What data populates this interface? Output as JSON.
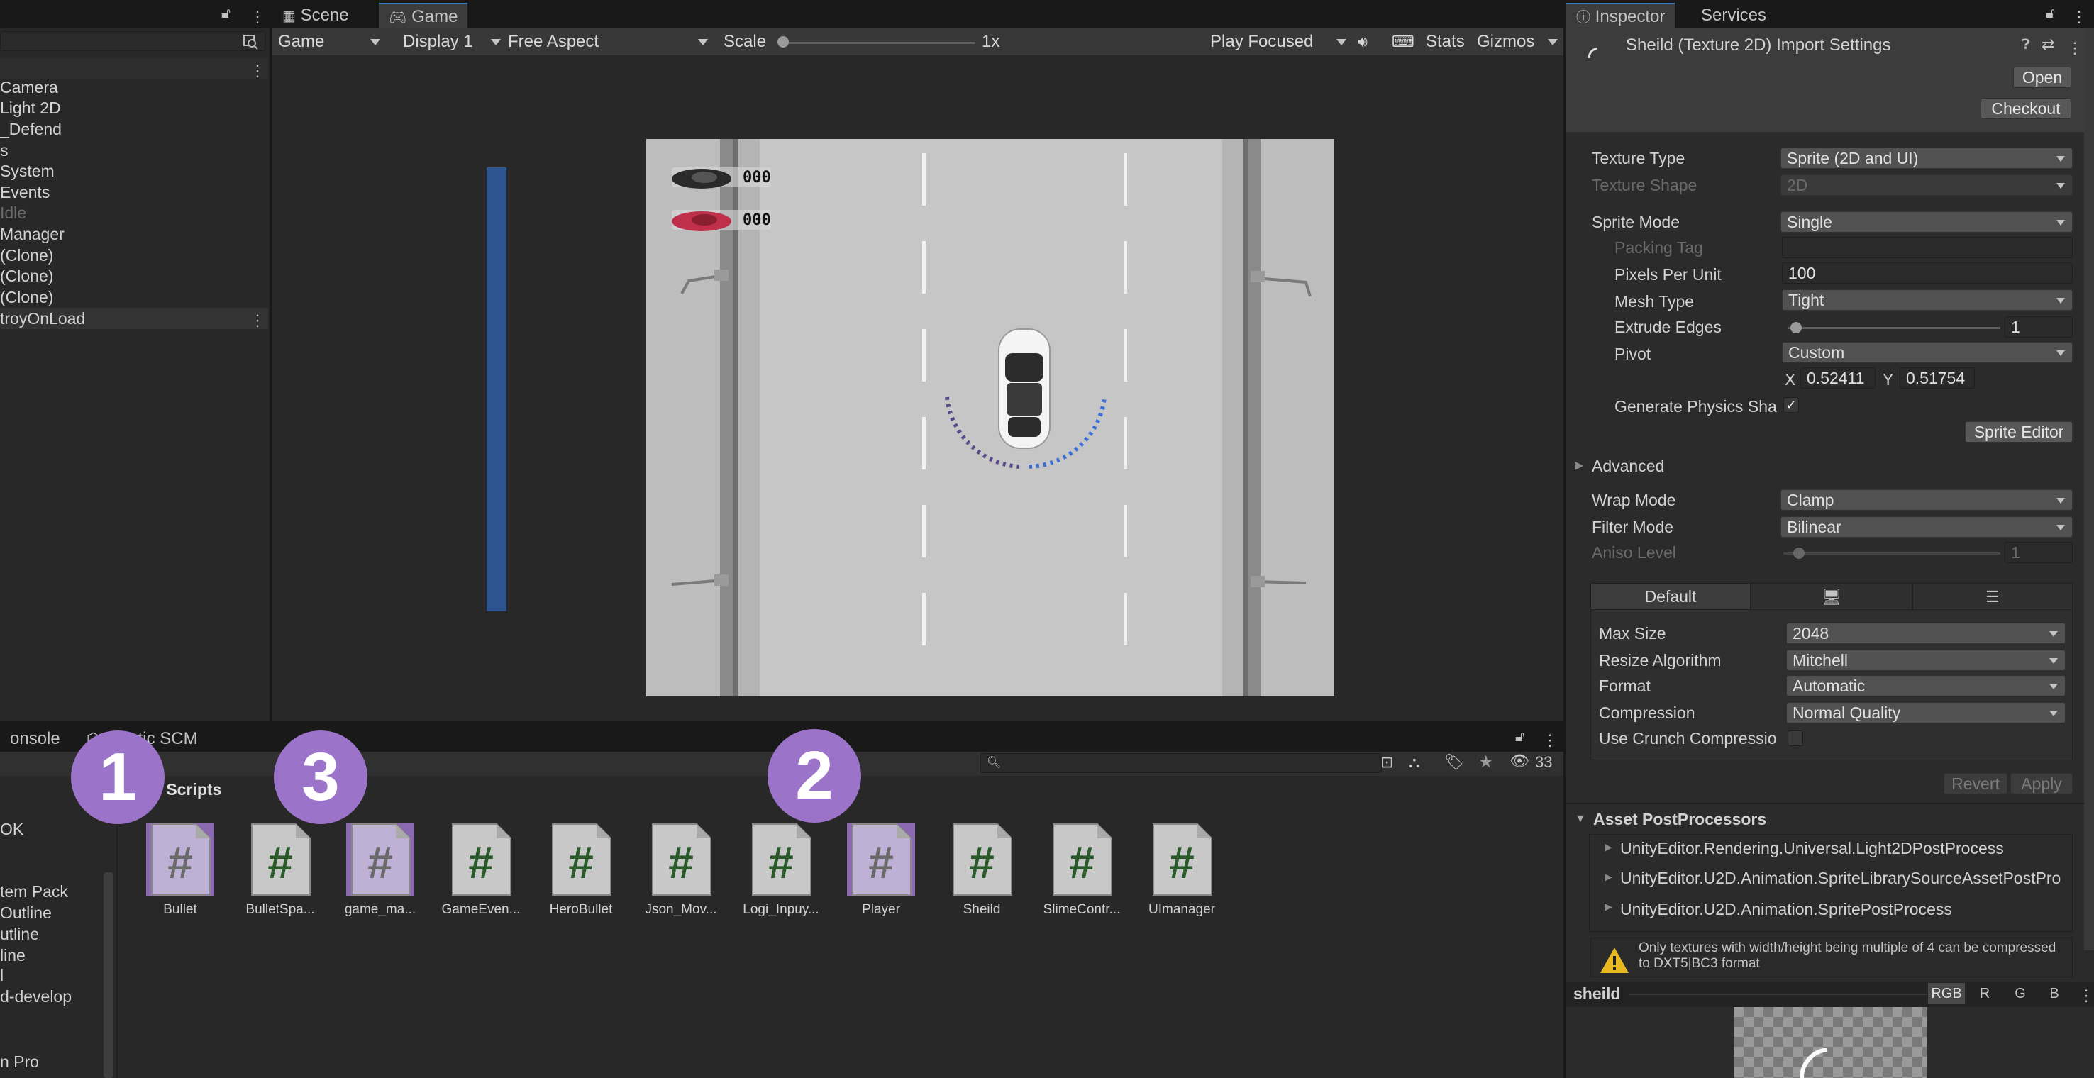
{
  "hierarchy": {
    "items": [
      "Camera",
      "Light 2D",
      "_Defend",
      "s",
      "System",
      "Events",
      "Idle",
      "Manager",
      "(Clone)",
      "(Clone)",
      "(Clone)",
      "troyOnLoad"
    ]
  },
  "tabs": {
    "scene": "Scene",
    "game": "Game",
    "inspector": "Inspector",
    "services": "Services",
    "console": "onsole",
    "plastic": "Plastic SCM"
  },
  "game_toolbar": {
    "mode": "Game",
    "display": "Display 1",
    "aspect": "Free Aspect",
    "scale_label": "Scale",
    "scale_value": "1x",
    "play_mode": "Play Focused",
    "stats": "Stats",
    "gizmos": "Gizmos"
  },
  "game_view": {
    "hud_score_1": "000",
    "hud_score_2": "000"
  },
  "inspector": {
    "title": "Sheild (Texture 2D) Import Settings",
    "open_button": "Open",
    "checkout_button": "Checkout",
    "texture_type_label": "Texture Type",
    "texture_type_value": "Sprite (2D and UI)",
    "texture_shape_label": "Texture Shape",
    "texture_shape_value": "2D",
    "sprite_mode_label": "Sprite Mode",
    "sprite_mode_value": "Single",
    "packing_tag_label": "Packing Tag",
    "pixels_per_unit_label": "Pixels Per Unit",
    "pixels_per_unit_value": "100",
    "mesh_type_label": "Mesh Type",
    "mesh_type_value": "Tight",
    "extrude_edges_label": "Extrude Edges",
    "extrude_edges_value": "1",
    "pivot_label": "Pivot",
    "pivot_value": "Custom",
    "pivot_x_label": "X",
    "pivot_x_value": "0.52411",
    "pivot_y_label": "Y",
    "pivot_y_value": "0.51754",
    "gen_physics_label": "Generate Physics Sha",
    "sprite_editor_button": "Sprite Editor",
    "advanced_label": "Advanced",
    "wrap_mode_label": "Wrap Mode",
    "wrap_mode_value": "Clamp",
    "filter_mode_label": "Filter Mode",
    "filter_mode_value": "Bilinear",
    "aniso_label": "Aniso Level",
    "aniso_value": "1",
    "platform_default": "Default",
    "max_size_label": "Max Size",
    "max_size_value": "2048",
    "resize_label": "Resize Algorithm",
    "resize_value": "Mitchell",
    "format_label": "Format",
    "format_value": "Automatic",
    "compression_label": "Compression",
    "compression_value": "Normal Quality",
    "crunch_label": "Use Crunch Compressio",
    "revert_button": "Revert",
    "apply_button": "Apply",
    "postprocessors_label": "Asset PostProcessors",
    "postprocessors": [
      "UnityEditor.Rendering.Universal.Light2DPostProcess",
      "UnityEditor.U2D.Animation.SpriteLibrarySourceAssetPostPro",
      "UnityEditor.U2D.Animation.SpritePostProcess"
    ],
    "warning_text": "Only textures with width/height being multiple of 4 can be compressed to DXT5|BC3 format",
    "preview_name": "sheild",
    "channels": [
      "RGB",
      "R",
      "G",
      "B"
    ]
  },
  "project": {
    "breadcrumb_parent": "ts",
    "breadcrumb_current": "Scripts",
    "hidden_count": "33",
    "sidebar_items": [
      "OK",
      "tem Pack",
      "Outline",
      "utline",
      "line",
      "l",
      "d-develop",
      "n Pro"
    ],
    "assets": [
      "Bullet",
      "BulletSpa...",
      "game_ma...",
      "GameEven...",
      "HeroBullet",
      "Json_Mov...",
      "Logi_Inpuy...",
      "Player",
      "Sheild",
      "SlimeContr...",
      "UImanager"
    ]
  },
  "badges": [
    "1",
    "2",
    "3"
  ],
  "colors": {
    "accent": "#3a79bb",
    "badge": "#9b74c9",
    "selected_asset": "#6e5a8c",
    "script_hash": "#2a5a2a"
  }
}
